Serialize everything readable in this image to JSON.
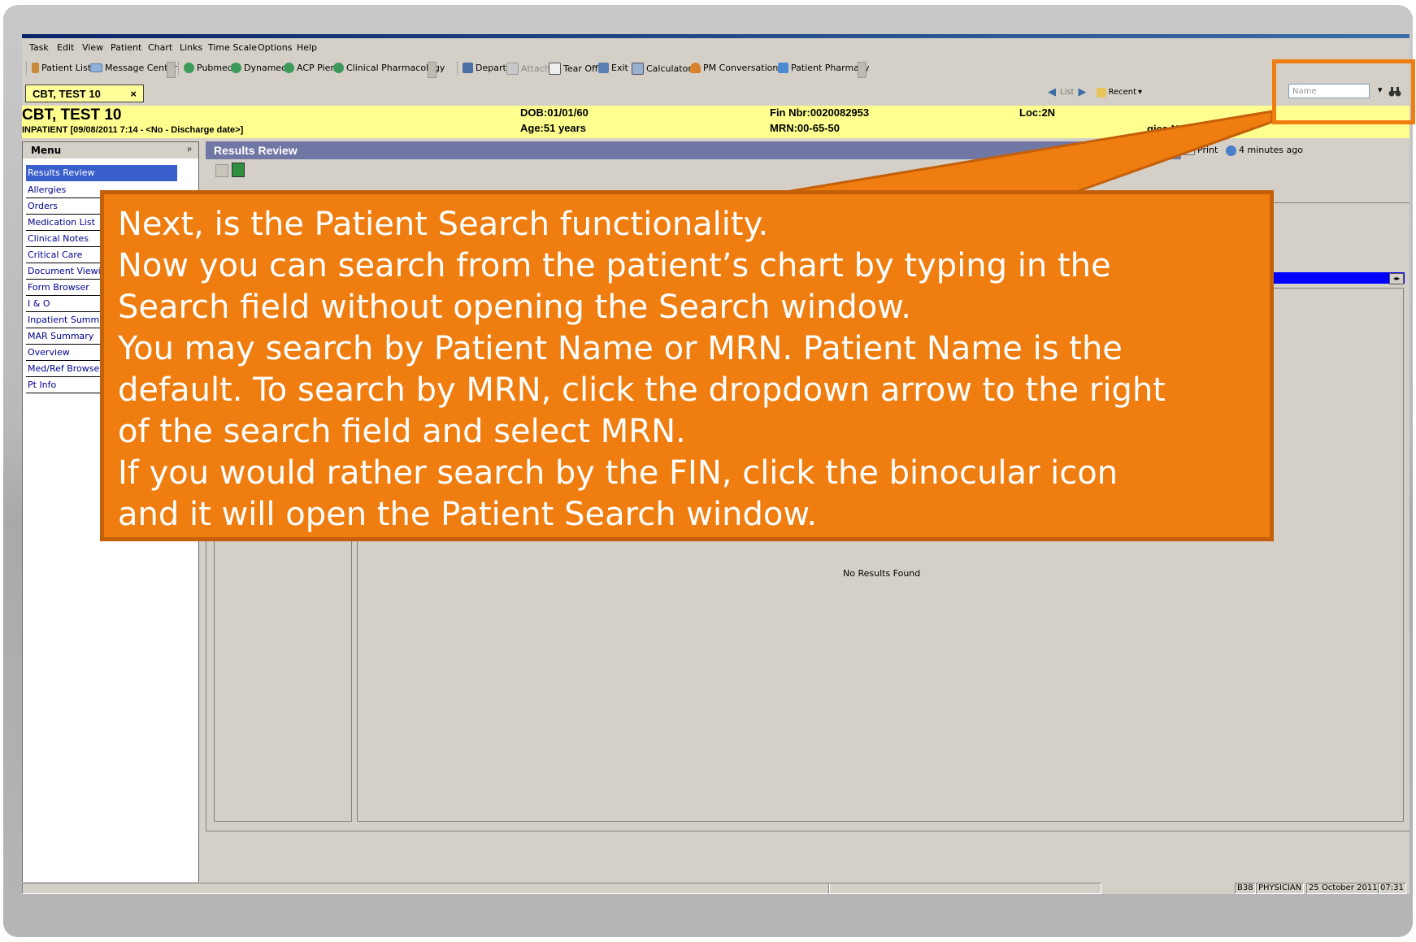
{
  "menubar": [
    "Task",
    "Edit",
    "View",
    "Patient",
    "Chart",
    "Links",
    "Time Scale",
    "Options",
    "Help"
  ],
  "toolbar": {
    "group1": [
      "Patient List",
      "Message Center"
    ],
    "group2": [
      "Pubmed",
      "Dynamed",
      "ACP Pier",
      "Clinical Pharmacology"
    ],
    "group3": [
      "Depart",
      "Attach",
      "Tear Off",
      "Exit",
      "Calculator",
      "PM Conversation",
      "Patient Pharmacy"
    ]
  },
  "patient_tab": {
    "label": "CBT, TEST 10",
    "close": "×"
  },
  "nav": {
    "list": "List",
    "recent": "Recent",
    "search_placeholder": "Name",
    "dropdown": "▾"
  },
  "banner": {
    "name": "CBT, TEST 10",
    "encounter": "INPATIENT [09/08/2011 7:14 - <No - Discharge date>]",
    "dob": "DOB:01/01/60",
    "age": "Age:51 years",
    "fin": "Fin Nbr:0020082953",
    "mrn": "MRN:00-65-50",
    "loc": "Loc:2N",
    "allergies": "gies Not Recorded"
  },
  "menu": {
    "title": "Menu",
    "pin": "ᵖ",
    "items": [
      "Results Review",
      "Allergies",
      "Orders",
      "Medication List",
      "Clinical Notes",
      "Critical Care",
      "Document Viewing",
      "Form Browser",
      "I & O",
      "Inpatient Summary",
      "MAR Summary",
      "Overview",
      "Med/Ref Browser",
      "Pt Info"
    ]
  },
  "content": {
    "title": "Results Review",
    "print": "Print",
    "updated": "4 minutes ago",
    "no_results": "No Results Found"
  },
  "status": {
    "code": "B38",
    "role": "PHYSICIAN",
    "date": "25 October 2011",
    "time": "07:31"
  },
  "callout": {
    "lines": [
      "Next, is the Patient Search functionality.",
      "Now you can search from the patient’s chart by typing in the",
      "Search field without opening the Search window.",
      "You may search by Patient Name or MRN. Patient Name is the",
      "default. To search by MRN, click the dropdown arrow to the right",
      "of the search field and select MRN.",
      "If you would rather search by the FIN, click the binocular icon",
      "and it will open the Patient Search window."
    ]
  },
  "colors": {
    "callout": "#ef7d0f",
    "banner": "#ffff8f",
    "header": "#7077a5",
    "selected": "#3a5fcd"
  }
}
